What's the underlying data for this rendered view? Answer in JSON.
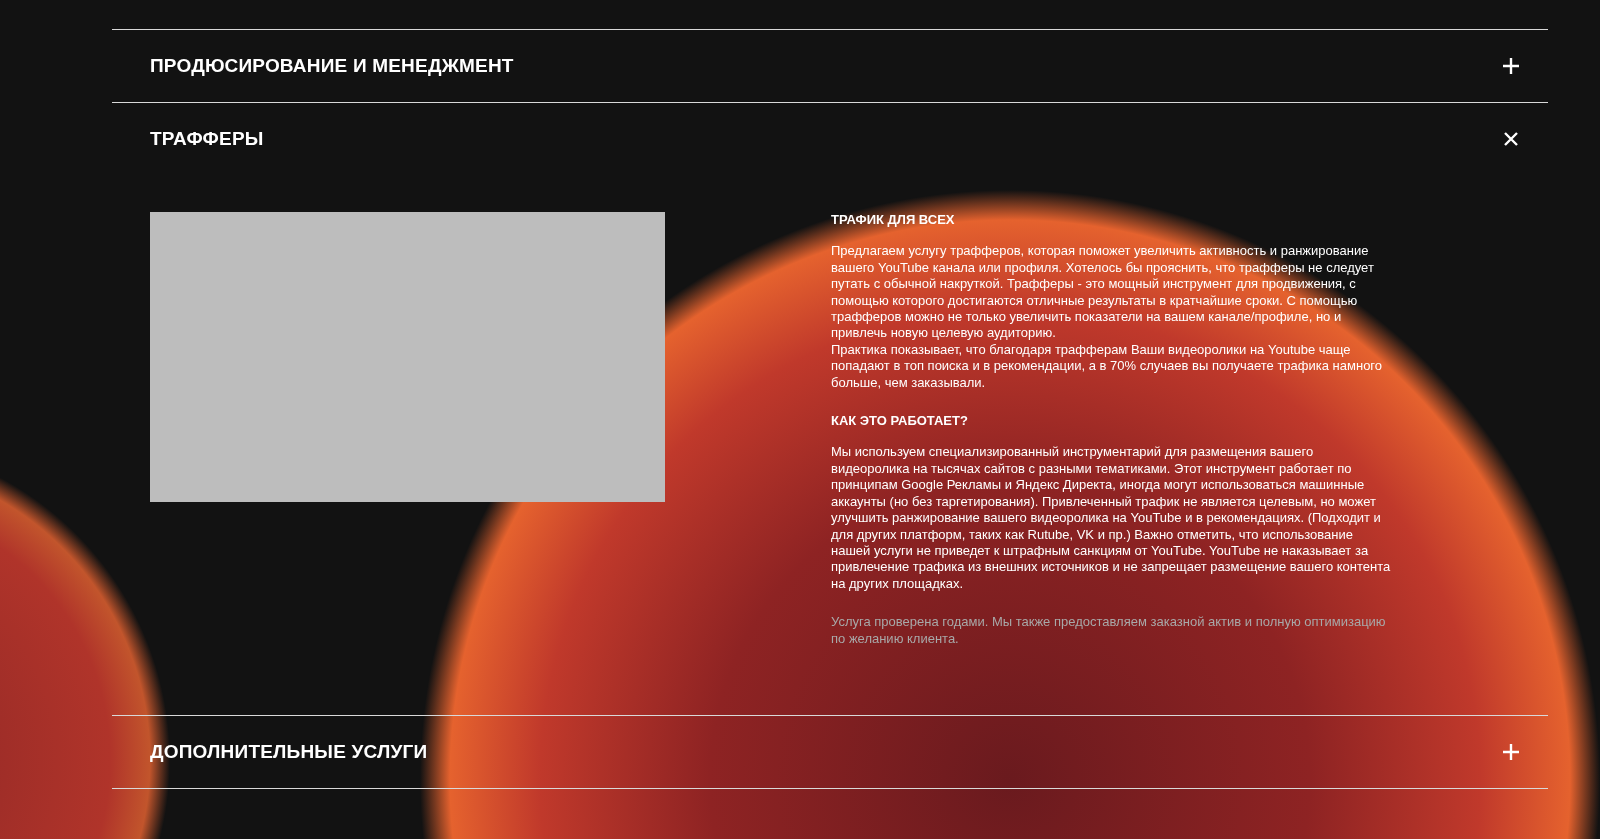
{
  "accordion": [
    {
      "title": "ПРОДЮСИРОВАНИЕ И МЕНЕДЖМЕНТ",
      "expanded": false
    },
    {
      "title": "ТРАФФЕРЫ",
      "expanded": true,
      "content": {
        "media": {
          "kind": "placeholder"
        },
        "blocks": [
          {
            "kind": "heading",
            "text": "ТРАФИК ДЛЯ ВСЕХ"
          },
          {
            "kind": "text",
            "paragraphs": [
              "Предлагаем услугу трафферов, которая поможет увеличить активность и ранжирование вашего YouTube канала или профиля. Хотелось бы прояснить, что трафферы не следует путать с обычной накруткой. Трафферы - это мощный инструмент для продвижения, с помощью которого достигаются отличные результаты в кратчайшие сроки. С помощью трафферов можно не только увеличить показатели на вашем канале/профиле, но и привлечь новую целевую аудиторию.",
              "Практика показывает, что благодаря трафферам Ваши видеоролики на Youtube чаще попадают в топ поиска и в рекомендации, а в 70% случаев вы получаете трафика намного больше, чем заказывали."
            ]
          },
          {
            "kind": "heading",
            "text": "КАК ЭТО РАБОТАЕТ?"
          },
          {
            "kind": "text",
            "paragraphs": [
              "Мы используем специализированный инструментарий для размещения вашего видеоролика на тысячах сайтов с разными тематиками. Этот инструмент работает по принципам Google Рекламы и Яндекс Директа, иногда могут использоваться машинные аккаунты (но без таргетирования). Привлеченный трафик не является целевым, но может улучшить ранжирование вашего видеоролика на YouTube и в рекомендациях. (Подходит и для других платформ, таких как Rutube, VK и пр.) Важно отметить, что использование нашей услуги не приведет к штрафным санкциям от YouTube. YouTube не наказывает за привлечение трафика из внешних источников и не запрещает размещение вашего контента на других площадках."
            ]
          },
          {
            "kind": "note",
            "paragraphs": [
              "Услуга проверена годами. Мы также предоставляем заказной актив и полную оптимизацию по желанию клиента."
            ]
          }
        ]
      }
    },
    {
      "title": "ДОПОЛНИТЕЛЬНЫЕ УСЛУГИ",
      "expanded": false
    }
  ]
}
